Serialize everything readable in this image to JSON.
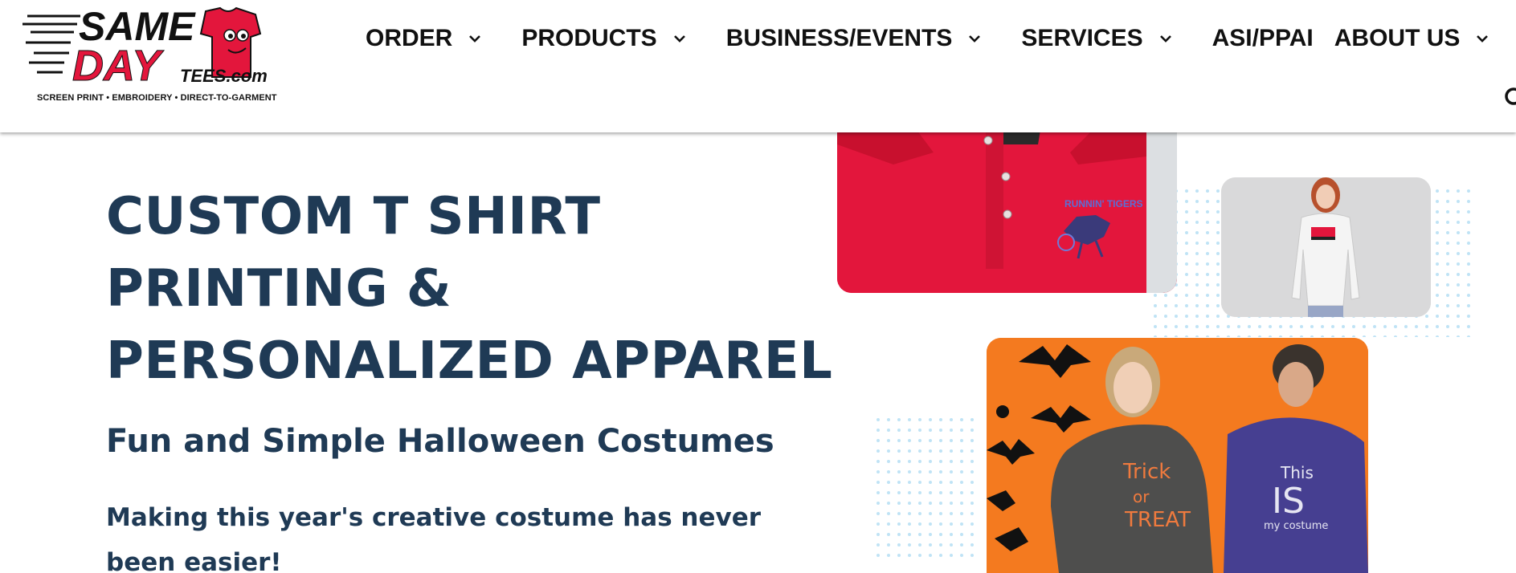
{
  "header": {
    "logo": {
      "word1": "SAME",
      "word2": "DAY",
      "word3": "TEES.com",
      "tagline": "SCREEN PRINT • EMBROIDERY • DIRECT-TO-GARMENT"
    },
    "nav": [
      {
        "label": "ORDER",
        "dropdown": true
      },
      {
        "label": "PRODUCTS",
        "dropdown": true
      },
      {
        "label": "BUSINESS/EVENTS",
        "dropdown": true
      },
      {
        "label": "SERVICES",
        "dropdown": true
      },
      {
        "label": "ASI/PPAI",
        "dropdown": false
      },
      {
        "label": "ABOUT US",
        "dropdown": true
      }
    ],
    "search_icon": "search-icon"
  },
  "hero": {
    "title_lines": [
      "CUSTOM T SHIRT",
      "PRINTING &",
      "PERSONALIZED APPAREL"
    ],
    "subtitle": "Fun and Simple Halloween Costumes",
    "description": "Making this year's creative costume has never been easier!"
  },
  "images": {
    "polo_print": "RUNNIN' TIGERS",
    "sweatshirt_text": [
      "Trick",
      "or",
      "TREAT"
    ],
    "tshirt_text": [
      "This",
      "IS",
      "my costume"
    ]
  },
  "colors": {
    "heading": "#1f3a55",
    "brand_red": "#e3163c",
    "nav_text": "#111111",
    "halloween_orange": "#f47a1f",
    "dot_blue": "#bfe3f5"
  }
}
